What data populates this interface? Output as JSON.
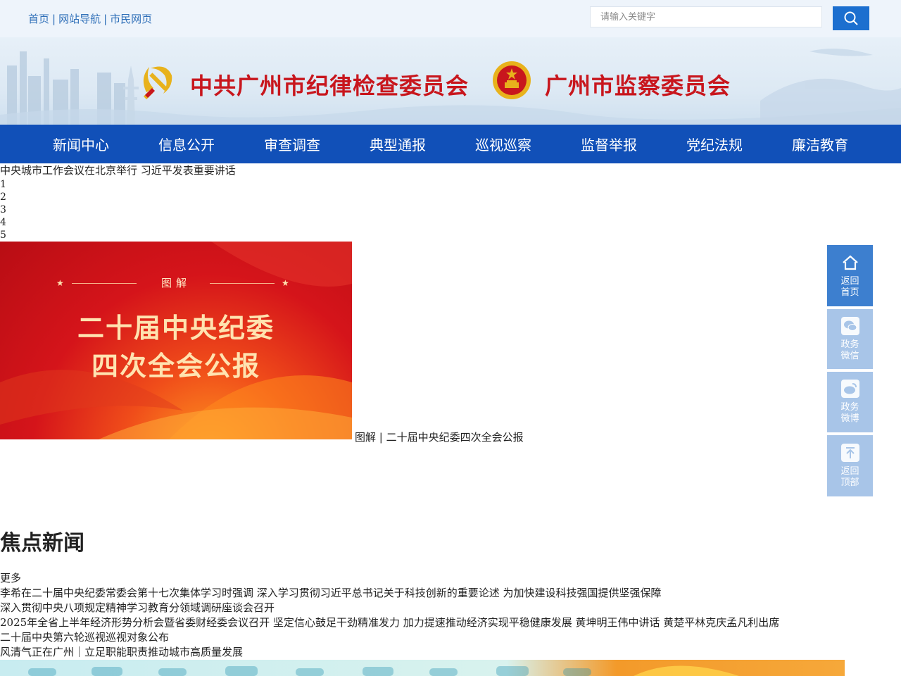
{
  "top_links": [
    {
      "label": "首页"
    },
    {
      "label": "网站导航"
    },
    {
      "label": "市民网页"
    }
  ],
  "link_separator": "|",
  "search": {
    "placeholder": "请输入关键字"
  },
  "icons": {
    "search": "search-icon",
    "party_emblem": "party-emblem-icon",
    "national_emblem": "national-emblem-icon",
    "home": "home-icon",
    "wechat": "wechat-icon",
    "weibo": "weibo-icon",
    "back_to_top": "arrow-up-icon"
  },
  "banner": {
    "title_left": "中共广州市纪律检查委员会",
    "title_right": "广州市监察委员会"
  },
  "nav": [
    {
      "label": "新闻中心"
    },
    {
      "label": "信息公开"
    },
    {
      "label": "审查调查"
    },
    {
      "label": "典型通报"
    },
    {
      "label": "巡视巡察"
    },
    {
      "label": "监督举报"
    },
    {
      "label": "党纪法规"
    },
    {
      "label": "廉洁教育"
    }
  ],
  "headline": "中央城市工作会议在北京举行 习近平发表重要讲话",
  "slide_numbers": [
    "1",
    "2",
    "3",
    "4",
    "5"
  ],
  "slide": {
    "tag": "图解",
    "line1": "二十届中央纪委",
    "line2": "四次全会公报",
    "caption": "图解 | 二十届中央纪委四次全会公报"
  },
  "focus_news": {
    "title": "焦点新闻",
    "more": "更多",
    "items": [
      "李希在二十届中央纪委常委会第十七次集体学习时强调 深入学习贯彻习近平总书记关于科技创新的重要论述 为加快建设科技强国提供坚强保障",
      "深入贯彻中央八项规定精神学习教育分领域调研座谈会召开",
      "2025年全省上半年经济形势分析会暨省委财经委会议召开 坚定信心鼓足干劲精准发力 加力提速推动经济实现平稳健康发展 黄坤明王伟中讲话 黄楚平林克庆孟凡利出席",
      "二十届中央第六轮巡视巡视对象公布",
      "风清气正在广州｜立足职能职责推动城市高质量发展"
    ]
  },
  "side_panel": [
    {
      "line1": "返回",
      "line2": "首页"
    },
    {
      "line1": "政务",
      "line2": "微信"
    },
    {
      "line1": "政务",
      "line2": "微博"
    },
    {
      "line1": "返回",
      "line2": "顶部"
    }
  ],
  "colors": {
    "nav_bg": "#1150b8",
    "link": "#2f6fb8",
    "accent_red": "#c8161d",
    "side_active": "#3d7fcf",
    "side_idle": "#a8c5e8"
  }
}
